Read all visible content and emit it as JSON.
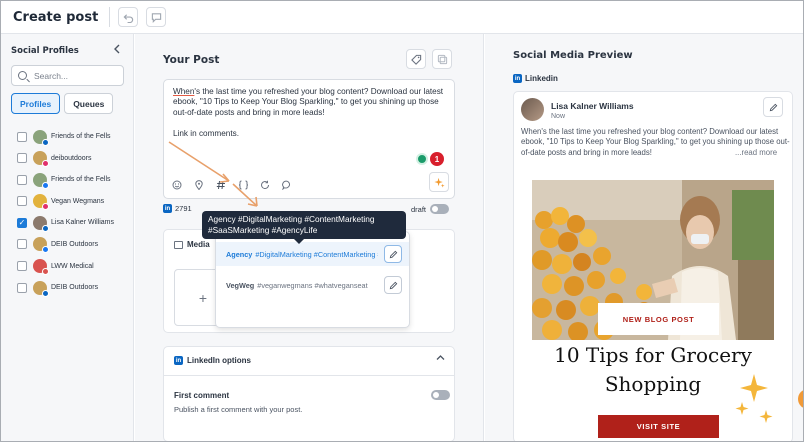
{
  "app": {
    "title": "Create post"
  },
  "sidebar": {
    "heading": "Social Profiles",
    "search_placeholder": "Search...",
    "tabs": [
      {
        "label": "Profiles",
        "active": true
      },
      {
        "label": "Queues",
        "active": false
      }
    ],
    "profiles": [
      {
        "name": "Friends of the Fells",
        "checked": false,
        "avatar_color": "#8aa37b",
        "network_color": "#0a66c2"
      },
      {
        "name": "deiboutdoors",
        "checked": false,
        "avatar_color": "#c8a15a",
        "network_color": "#e1306c"
      },
      {
        "name": "Friends of the Fells",
        "checked": false,
        "avatar_color": "#8aa37b",
        "network_color": "#1877f2"
      },
      {
        "name": "Vegan Wegmans",
        "checked": false,
        "avatar_color": "#e2b23d",
        "network_color": "#e1306c"
      },
      {
        "name": "Lisa Kalner Williams",
        "checked": true,
        "avatar_color": "#8c7a6d",
        "network_color": "#0a66c2"
      },
      {
        "name": "DEIB Outdoors",
        "checked": false,
        "avatar_color": "#c8a15a",
        "network_color": "#1877f2"
      },
      {
        "name": "LWW Medical",
        "checked": false,
        "avatar_color": "#d9534f",
        "network_color": "#d9534f"
      },
      {
        "name": "DEIB Outdoors",
        "checked": false,
        "avatar_color": "#c8a15a",
        "network_color": "#0a66c2"
      }
    ]
  },
  "post": {
    "heading": "Your Post",
    "text_underlined": "When",
    "text_rest": "'s the last time you refreshed your blog content? Download our latest ebook, \"10 Tips to Keep Your Blog Sparkling,\" to get you shining up those out-of-date posts and bring in more leads!",
    "text_line2": "Link in comments.",
    "grammar_alert_count": "1",
    "char_count": "2791",
    "draft_label": "draft"
  },
  "hashtag_tooltip": "Agency #DigitalMarketing #ContentMarketing #SaaSMarketing #AgencyLife",
  "hashtag_groups": [
    {
      "name": "Agency",
      "tags": "#DigitalMarketing #ContentMarketing #SaaSMarketing #AgencyLife",
      "selected": true
    },
    {
      "name": "VegWeg",
      "tags": "#veganwegmans #whatveganseat",
      "selected": false
    }
  ],
  "media": {
    "heading": "Media",
    "add_symbol": "+"
  },
  "linkedin_options": {
    "heading": "LinkedIn options",
    "first_comment_title": "First comment",
    "first_comment_desc": "Publish a first comment with your post."
  },
  "preview": {
    "heading": "Social Media Preview",
    "network": "Linkedin",
    "author": "Lisa Kalner Williams",
    "time": "Now",
    "body": "When's the last time you refreshed your blog content? Download our latest ebook, \"10 Tips to Keep Your Blog Sparkling,\" to get you shining up those out-of-date posts and bring in more leads!",
    "read_more": "...read more",
    "image": {
      "banner": "NEW BLOG POST",
      "headline_line1": "10 Tips for Grocery",
      "headline_line2": "Shopping",
      "cta": "VISIT SITE"
    }
  },
  "colors": {
    "accent": "#1d7bd8",
    "linkedin": "#0a66c2",
    "brand_red": "#b0211a",
    "alert_red": "#d81f2c",
    "annotation_arrow": "#e8a06a"
  }
}
